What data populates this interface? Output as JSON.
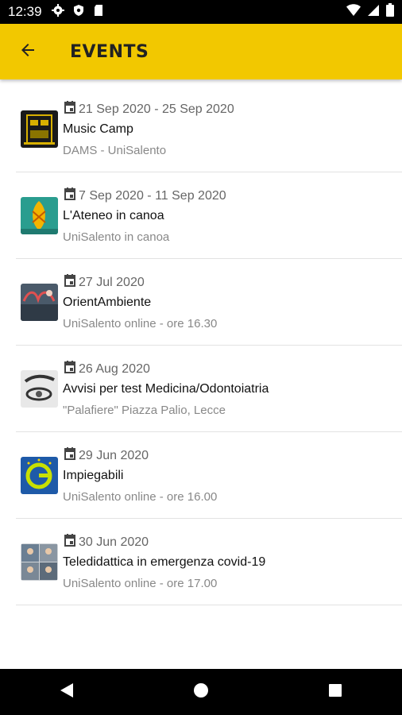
{
  "status_bar": {
    "time": "12:39",
    "icons_left": [
      "gear-icon",
      "shield-icon",
      "sd-card-icon"
    ],
    "icons_right": [
      "wifi-icon",
      "signal-icon",
      "battery-icon"
    ]
  },
  "app_bar": {
    "title": "EVENTS",
    "back_icon": "arrow-left-icon",
    "background": "#f2c800"
  },
  "events": [
    {
      "date": "21 Sep 2020 - 25 Sep 2020",
      "title": "Music Camp",
      "subtitle": "DAMS - UniSalento"
    },
    {
      "date": "7 Sep 2020 - 11 Sep 2020",
      "title": "L'Ateneo in canoa",
      "subtitle": "UniSalento in canoa"
    },
    {
      "date": "27 Jul 2020",
      "title": "OrientAmbiente",
      "subtitle": "UniSalento online - ore 16.30"
    },
    {
      "date": "26 Aug 2020",
      "title": "Avvisi per test Medicina/Odontoiatria",
      "subtitle": "\"Palafiere\" Piazza Palio, Lecce"
    },
    {
      "date": "29 Jun 2020",
      "title": "Impiegabili",
      "subtitle": "UniSalento online - ore 16.00"
    },
    {
      "date": "30 Jun 2020",
      "title": "Teledidattica in emergenza covid-19",
      "subtitle": "UniSalento online - ore 17.00"
    }
  ],
  "nav_bar": {
    "icons": [
      "back-triangle-icon",
      "home-circle-icon",
      "recents-square-icon"
    ]
  }
}
